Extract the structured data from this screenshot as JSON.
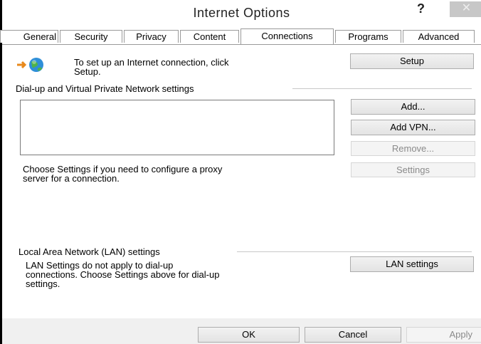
{
  "window": {
    "title": "Internet Options",
    "help_glyph": "?",
    "close_glyph": "✕"
  },
  "tabs": [
    {
      "label": "General"
    },
    {
      "label": "Security"
    },
    {
      "label": "Privacy"
    },
    {
      "label": "Content"
    },
    {
      "label": "Connections"
    },
    {
      "label": "Programs"
    },
    {
      "label": "Advanced"
    }
  ],
  "active_tab": "Connections",
  "setup": {
    "text": "To set up an Internet connection, click\nSetup.",
    "button": "Setup"
  },
  "dialup": {
    "group_label": "Dial-up and Virtual Private Network settings",
    "add_button": "Add...",
    "add_vpn_button": "Add VPN...",
    "remove_button": "Remove...",
    "proxy_text": "Choose Settings if you need to configure a proxy\nserver for a connection.",
    "settings_button": "Settings"
  },
  "lan": {
    "group_label": "Local Area Network (LAN) settings",
    "text": "LAN Settings do not apply to dial-up\nconnections. Choose Settings above for dial-up\nsettings.",
    "button": "LAN settings"
  },
  "footer": {
    "ok": "OK",
    "cancel": "Cancel",
    "apply": "Apply"
  }
}
